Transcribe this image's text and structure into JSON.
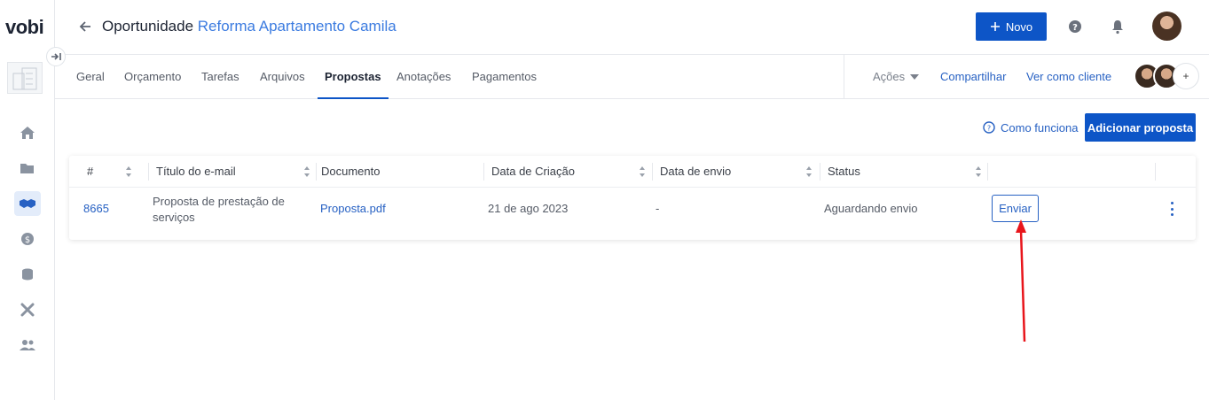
{
  "app": {
    "logo": "vobi"
  },
  "header": {
    "title_prefix": "Oportunidade",
    "title_name": "Reforma Apartamento Camila",
    "new_button": "Novo"
  },
  "tabs": [
    {
      "label": "Geral"
    },
    {
      "label": "Orçamento"
    },
    {
      "label": "Tarefas"
    },
    {
      "label": "Arquivos"
    },
    {
      "label": "Propostas",
      "active": true
    },
    {
      "label": "Anotações"
    },
    {
      "label": "Pagamentos"
    }
  ],
  "toolbar": {
    "acoes": "Ações",
    "share": "Compartilhar",
    "view_as_client": "Ver como cliente"
  },
  "actions": {
    "how_it_works": "Como funciona",
    "add_proposal": "Adicionar proposta"
  },
  "table": {
    "columns": [
      "#",
      "Título do e-mail",
      "Documento",
      "Data de Criação",
      "Data de envio",
      "Status"
    ],
    "rows": [
      {
        "id": "8665",
        "title_line1": "Proposta de prestação de",
        "title_line2": "serviços",
        "document": "Proposta.pdf",
        "created": "21 de ago 2023",
        "sent": "-",
        "status": "Aguardando envio",
        "action": "Enviar"
      }
    ]
  },
  "colors": {
    "primary": "#0d55c7",
    "link": "#2761c3",
    "annotation_arrow": "#e8151b"
  },
  "icons": [
    "back-arrow-icon",
    "plus-icon",
    "help-icon",
    "bell-icon",
    "home-icon",
    "folder-icon",
    "handshake-icon",
    "dollar-icon",
    "coins-icon",
    "tools-icon",
    "users-icon",
    "chevron-down-icon",
    "sort-icon",
    "kebab-menu-icon"
  ]
}
